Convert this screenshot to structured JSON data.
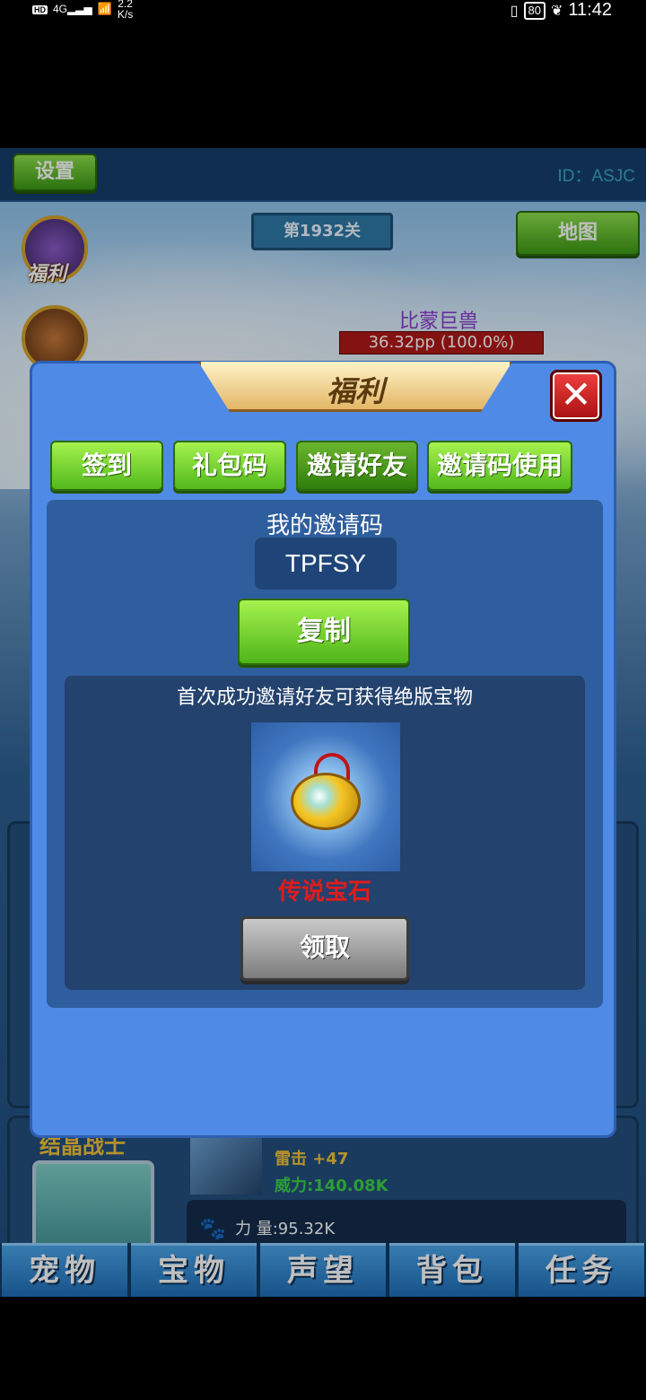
{
  "status_bar": {
    "hd": "HD",
    "network": "4G",
    "speed_value": "2.2",
    "speed_unit": "K/s",
    "battery": "80",
    "time": "11:42"
  },
  "game": {
    "settings_label": "设置",
    "player_id": "ID：ASJC",
    "level": "第1932关",
    "map_label": "地图",
    "side_icon_label": "福利",
    "enemy_name": "比蒙巨兽",
    "enemy_hp": "36.32pp (100.0%)",
    "hero_name": "结晶战士",
    "skill_name": "雷击   +47",
    "skill_power": "威力:140.08K",
    "stat_label": "力  量:95.32K"
  },
  "bottom_tabs": [
    {
      "label": "宠物"
    },
    {
      "label": "宝物"
    },
    {
      "label": "声望"
    },
    {
      "label": "背包"
    },
    {
      "label": "任务"
    }
  ],
  "modal": {
    "title": "福利",
    "close_symbol": "✕",
    "tabs": [
      {
        "label": "签到"
      },
      {
        "label": "礼包码"
      },
      {
        "label": "邀请好友"
      },
      {
        "label": "邀请码使用"
      }
    ],
    "active_tab": "邀请好友",
    "invite_code_label": "我的邀请码",
    "invite_code": "TPFSY",
    "copy_label": "复制",
    "reward_description": "首次成功邀请好友可获得绝版宝物",
    "reward_name": "传说宝石",
    "claim_label": "领取"
  },
  "colors": {
    "modal_bg": "#4f8ae6",
    "green_button": "#52b81c",
    "reward_red": "#e01c1c",
    "claim_gray": "#7c7c7c"
  }
}
